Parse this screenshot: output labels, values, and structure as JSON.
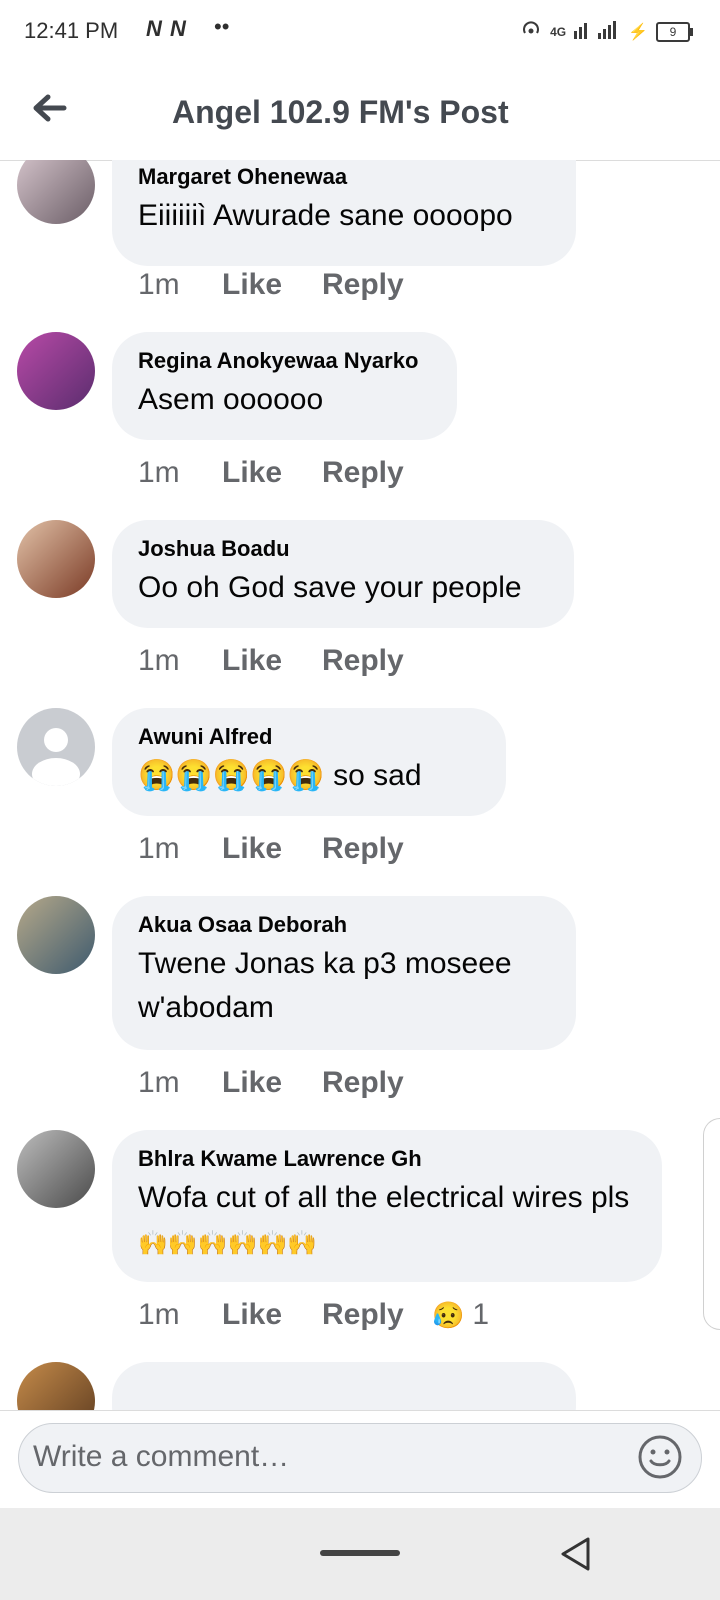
{
  "status_bar": {
    "time": "12:41 PM",
    "carrier_icons": "N N",
    "dots": "••",
    "network": "4G",
    "battery": "9"
  },
  "header": {
    "title": "Angel 102.9 FM's Post",
    "back_icon": "back-arrow-icon"
  },
  "comments": [
    {
      "author": "Margaret Ohenewaa",
      "text": "Eiiiiiiì Awurade sane oooopo",
      "time": "1m",
      "like": "Like",
      "reply": "Reply",
      "avatar_color": "#8a7b86"
    },
    {
      "author": "Regina Anokyewaa Nyarko",
      "text": "Asem oooooo",
      "time": "1m",
      "like": "Like",
      "reply": "Reply",
      "avatar_color": "#8f3c88"
    },
    {
      "author": "Joshua Boadu",
      "text": "Oo oh God save your people",
      "time": "1m",
      "like": "Like",
      "reply": "Reply",
      "avatar_color": "#a65d3b"
    },
    {
      "author": "Awuni Alfred",
      "text_emoji": "😭😭😭😭😭",
      "text": "so  sad",
      "time": "1m",
      "like": "Like",
      "reply": "Reply",
      "avatar_color": "#c9ccd1"
    },
    {
      "author": "Akua Osaa Deborah",
      "text": "Twene Jonas ka p3 moseee w'abodam",
      "time": "1m",
      "like": "Like",
      "reply": "Reply",
      "avatar_color": "#7a8a6b"
    },
    {
      "author": "Bhlra Kwame Lawrence Gh",
      "text": "Wofa cut of all the electrical wires pls",
      "text_emoji": "🙌🙌🙌🙌🙌🙌",
      "time": "1m",
      "like": "Like",
      "reply": "Reply",
      "reaction_emoji": "😥",
      "reaction_count": "1",
      "avatar_color": "#6b6b6b"
    }
  ],
  "composer": {
    "placeholder": "Write a comment…",
    "emoji_icon": "smiley-icon"
  },
  "nav": {
    "home_icon": "home-pill-icon",
    "back_icon": "triangle-back-icon"
  }
}
